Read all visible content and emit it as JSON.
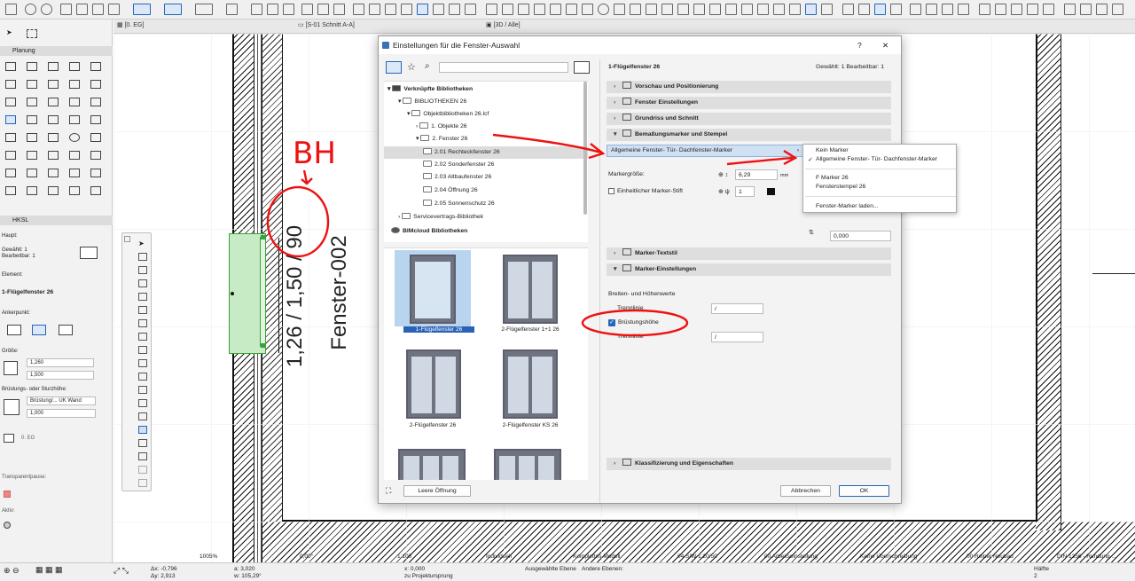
{
  "tabs": [
    "[0. EG]",
    "[S-01 Schnitt A-A]",
    "[3D / Alle]"
  ],
  "left_panel": {
    "planung_header": "Planung",
    "hksl_header": "HKSL",
    "haupt_label": "Haupt:",
    "gewaehlt": "Gewählt: 1",
    "bearbeitbar": "Bearbeitbar: 1",
    "element_label": "Element:",
    "element_value": "1-Flügelfenster 26",
    "ankerpunkt_label": "Ankerpunkt:",
    "groesse_label": "Größe:",
    "width_value": "1,260",
    "height_value": "1,500",
    "bruestung_label": "Brüstungs- oder Sturzhöhe:",
    "bruestung_select": "Brüstung/... UK Wand",
    "bruestung_value": "1,000",
    "story_value": "0. EG",
    "transparent_label": "Transparentpause:",
    "aktiv_label": "Aktiv:"
  },
  "canvas": {
    "window_dims_label": "1,26 / 1,50 / 90",
    "window_id_label": "Fenster-002",
    "annotation_text": "BH"
  },
  "dialog": {
    "title": "Einstellungen für die Fenster-Auswahl",
    "help": "?",
    "close": "✕",
    "library_tree": [
      {
        "label": "Verknüpfte Bibliotheken",
        "bold": true
      },
      {
        "label": "BIBLIOTHEKEN 26"
      },
      {
        "label": "Objektbibliotheken 26.lcf"
      },
      {
        "label": "1. Objekte 26"
      },
      {
        "label": "2. Fenster 26"
      },
      {
        "label": "2.01 Rechteckfenster 26",
        "selected": true
      },
      {
        "label": "2.02 Sonderfenster 26"
      },
      {
        "label": "2.03 Altbaufenster 26"
      },
      {
        "label": "2.04 Öffnung 26"
      },
      {
        "label": "2.05 Sonnenschutz 26"
      },
      {
        "label": "Servicevertrags-Bibliothek"
      },
      {
        "label": "BIMcloud Bibliotheken",
        "bold": true
      }
    ],
    "thumbnails": [
      "1-Flügelfenster 26",
      "2-Flügelfenster 1+1 26",
      "2-Flügelfenster 26",
      "2-Flügelfenster KS 26"
    ],
    "leere_oeffnung": "Leere Öffnung",
    "element_name": "1-Flügelfenster 26",
    "selection_info": "Gewählt: 1 Bearbeitbar: 1",
    "sections": {
      "vorschau": "Vorschau und Positionierung",
      "fenster": "Fenster Einstellungen",
      "grundriss": "Grundriss und Schnitt",
      "bemassung": "Bemaßungsmarker und Stempel",
      "marker_textstil": "Marker-Textstil",
      "marker_einstellungen": "Marker-Einstellungen",
      "klassifizierung": "Klassifizierung und Eigenschaften"
    },
    "marker_dropdown": "Allgemeine Fenster- Tür- Dachfenster-Marker",
    "markergroesse_label": "Markergröße:",
    "markergroesse_value": "6,29",
    "markergroesse_unit": "mm",
    "einheitlicher_label": "Einheitlicher Marker-Stift",
    "pen_value": "1",
    "offset_value": "0,000",
    "breiten_label": "Breiten- und Höhenwerte",
    "trennlinie_label": "Trennlinie",
    "trennlinie1_value": "/",
    "bruestungshoehe_label": "Brüstungshöhe",
    "trennlinie2_label": "Trennlinie",
    "trennlinie2_value": "/",
    "cancel": "Abbrechen",
    "ok": "OK"
  },
  "menu": {
    "items": [
      "Kein Marker",
      "Allgemeine Fenster- Tür- Dachfenster-Marker",
      "F Marker 26",
      "Fensterstempel 26",
      "Fenster-Marker laden..."
    ],
    "checked": "✓"
  },
  "statusbar": {
    "zoom": "1005%",
    "dx": "Δx: -0,796",
    "dy": "Δy: 2,913",
    "a": "a: 3,020",
    "w": "w: 105,29°",
    "angle": "0,00°",
    "scale": "1:100",
    "coord_x": "x: 0,000",
    "projection": "zu Projektursprung",
    "ausgew_ebene": "Ausgewählte Ebene",
    "individuell": "Individuell",
    "andere_ebenen": "Andere Ebenen:",
    "komplettes_modell": "Komplettes Modell",
    "sw": "04 S/W 1:20/50",
    "arbeitseinstellung": "00 Arbeitseinstellung",
    "keine_ueberschreibung": "Keine Überschreibung",
    "neubau": "00 Reiner Neubau",
    "haelfte": "Hälfte",
    "haelfte_num": "2",
    "din": "DIN 1356 - Rundung ..."
  }
}
